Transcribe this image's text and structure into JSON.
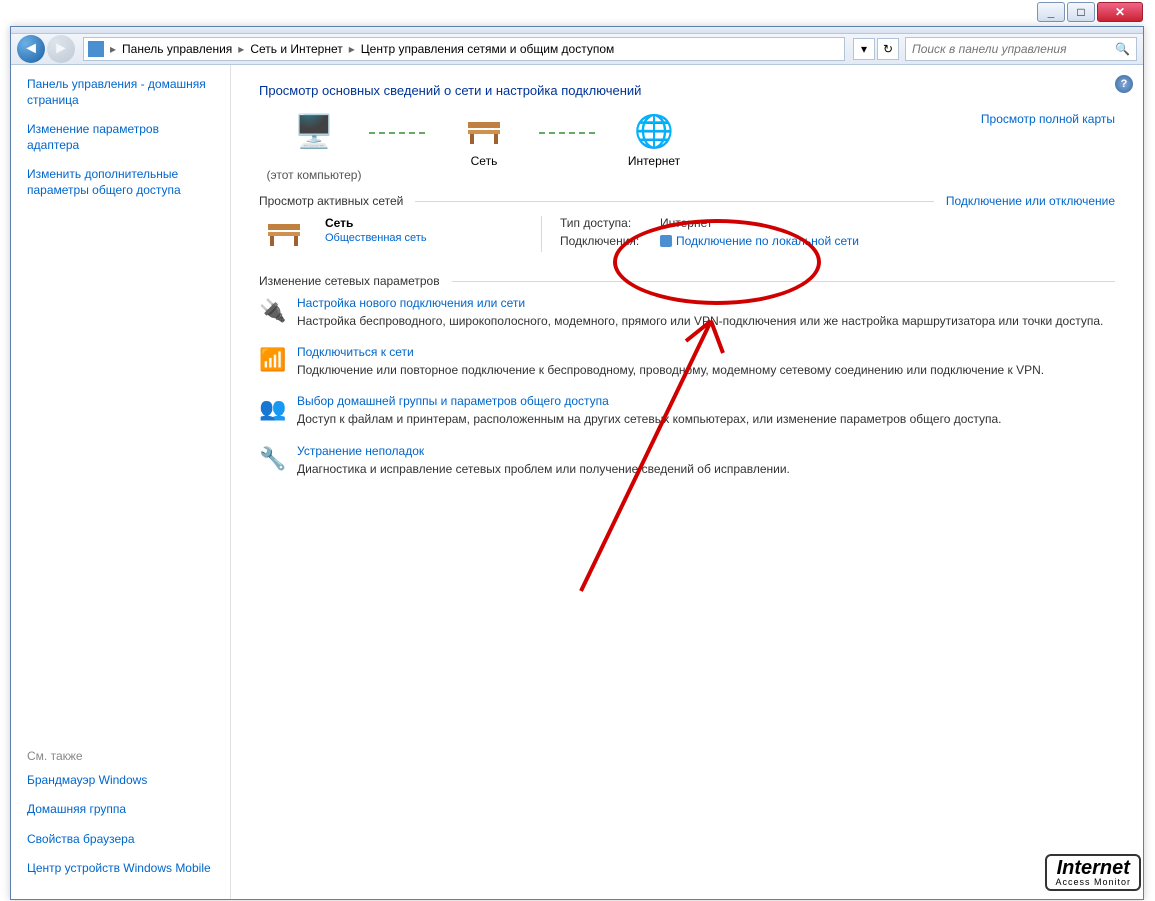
{
  "window": {
    "min": "_",
    "max": "□",
    "close": "✕"
  },
  "breadcrumb": {
    "items": [
      "Панель управления",
      "Сеть и Интернет",
      "Центр управления сетями и общим доступом"
    ]
  },
  "search": {
    "placeholder": "Поиск в панели управления"
  },
  "sidebar": {
    "links": [
      "Панель управления - домашняя страница",
      "Изменение параметров адаптера",
      "Изменить дополнительные параметры общего доступа"
    ],
    "also_title": "См. также",
    "also": [
      "Брандмауэр Windows",
      "Домашняя группа",
      "Свойства браузера",
      "Центр устройств Windows Mobile"
    ]
  },
  "main": {
    "heading": "Просмотр основных сведений о сети и настройка подключений",
    "map": {
      "n1": "(этот компьютер)",
      "n2": "Сеть",
      "n3": "Интернет",
      "full": "Просмотр полной карты"
    },
    "active": {
      "title": "Просмотр активных сетей",
      "link": "Подключение или отключение",
      "net_name": "Сеть",
      "net_type": "Общественная сеть",
      "k1": "Тип доступа:",
      "v1": "Интернет",
      "k2": "Подключения:",
      "v2": "Подключение по локальной сети"
    },
    "change": {
      "title": "Изменение сетевых параметров",
      "items": [
        {
          "t": "Настройка нового подключения или сети",
          "d": "Настройка беспроводного, широкополосного, модемного, прямого или VPN-подключения или же настройка маршрутизатора или точки доступа."
        },
        {
          "t": "Подключиться к сети",
          "d": "Подключение или повторное подключение к беспроводному, проводному, модемному сетевому соединению или подключение к VPN."
        },
        {
          "t": "Выбор домашней группы и параметров общего доступа",
          "d": "Доступ к файлам и принтерам, расположенным на других сетевых компьютерах, или изменение параметров общего доступа."
        },
        {
          "t": "Устранение неполадок",
          "d": "Диагностика и исправление сетевых проблем или получение сведений об исправлении."
        }
      ]
    }
  },
  "watermark": {
    "l1": "Internet",
    "l2": "Access Monitor"
  }
}
